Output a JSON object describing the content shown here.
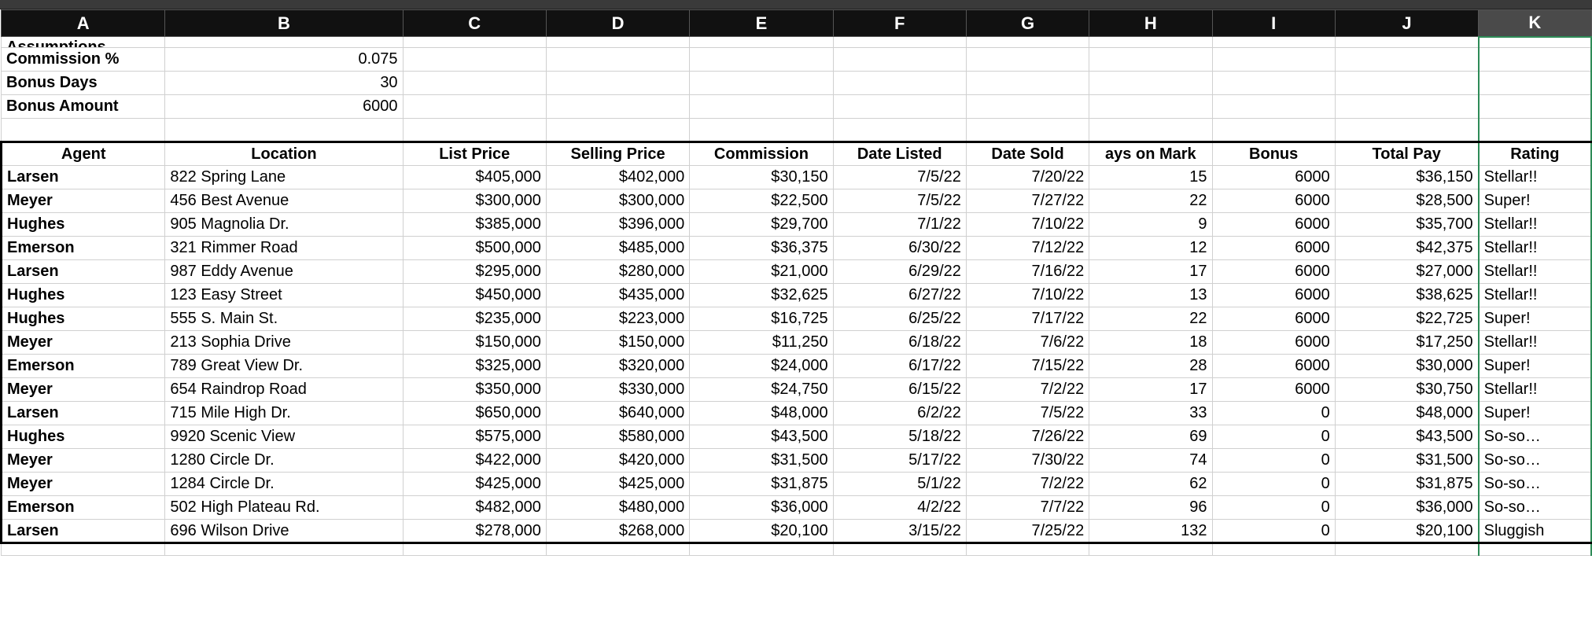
{
  "columns": [
    "A",
    "B",
    "C",
    "D",
    "E",
    "F",
    "G",
    "H",
    "I",
    "J",
    "K"
  ],
  "selected_column": "K",
  "assumptions_partial_label": "Assumptions",
  "assumptions": [
    {
      "label": "Commission %",
      "value": "0.075"
    },
    {
      "label": "Bonus Days",
      "value": "30"
    },
    {
      "label": "Bonus Amount",
      "value": "6000"
    }
  ],
  "headers": {
    "agent": "Agent",
    "location": "Location",
    "list_price": "List Price",
    "selling_price": "Selling Price",
    "commission": "Commission",
    "date_listed": "Date Listed",
    "date_sold": "Date Sold",
    "days_on_market": "ays on Mark",
    "bonus": "Bonus",
    "total_pay": "Total Pay",
    "rating": "Rating"
  },
  "rows": [
    {
      "agent": "Larsen",
      "location": "822 Spring Lane",
      "list_price": "$405,000",
      "selling_price": "$402,000",
      "commission": "$30,150",
      "date_listed": "7/5/22",
      "date_sold": "7/20/22",
      "days": "15",
      "bonus": "6000",
      "total_pay": "$36,150",
      "rating": "Stellar!!"
    },
    {
      "agent": "Meyer",
      "location": "456 Best Avenue",
      "list_price": "$300,000",
      "selling_price": "$300,000",
      "commission": "$22,500",
      "date_listed": "7/5/22",
      "date_sold": "7/27/22",
      "days": "22",
      "bonus": "6000",
      "total_pay": "$28,500",
      "rating": "Super!"
    },
    {
      "agent": "Hughes",
      "location": "905 Magnolia Dr.",
      "list_price": "$385,000",
      "selling_price": "$396,000",
      "commission": "$29,700",
      "date_listed": "7/1/22",
      "date_sold": "7/10/22",
      "days": "9",
      "bonus": "6000",
      "total_pay": "$35,700",
      "rating": "Stellar!!"
    },
    {
      "agent": "Emerson",
      "location": "321 Rimmer Road",
      "list_price": "$500,000",
      "selling_price": "$485,000",
      "commission": "$36,375",
      "date_listed": "6/30/22",
      "date_sold": "7/12/22",
      "days": "12",
      "bonus": "6000",
      "total_pay": "$42,375",
      "rating": "Stellar!!"
    },
    {
      "agent": "Larsen",
      "location": "987 Eddy Avenue",
      "list_price": "$295,000",
      "selling_price": "$280,000",
      "commission": "$21,000",
      "date_listed": "6/29/22",
      "date_sold": "7/16/22",
      "days": "17",
      "bonus": "6000",
      "total_pay": "$27,000",
      "rating": "Stellar!!"
    },
    {
      "agent": "Hughes",
      "location": "123 Easy Street",
      "list_price": "$450,000",
      "selling_price": "$435,000",
      "commission": "$32,625",
      "date_listed": "6/27/22",
      "date_sold": "7/10/22",
      "days": "13",
      "bonus": "6000",
      "total_pay": "$38,625",
      "rating": "Stellar!!"
    },
    {
      "agent": "Hughes",
      "location": "555 S. Main St.",
      "list_price": "$235,000",
      "selling_price": "$223,000",
      "commission": "$16,725",
      "date_listed": "6/25/22",
      "date_sold": "7/17/22",
      "days": "22",
      "bonus": "6000",
      "total_pay": "$22,725",
      "rating": "Super!"
    },
    {
      "agent": "Meyer",
      "location": "213 Sophia Drive",
      "list_price": "$150,000",
      "selling_price": "$150,000",
      "commission": "$11,250",
      "date_listed": "6/18/22",
      "date_sold": "7/6/22",
      "days": "18",
      "bonus": "6000",
      "total_pay": "$17,250",
      "rating": "Stellar!!"
    },
    {
      "agent": "Emerson",
      "location": "789 Great View Dr.",
      "list_price": "$325,000",
      "selling_price": "$320,000",
      "commission": "$24,000",
      "date_listed": "6/17/22",
      "date_sold": "7/15/22",
      "days": "28",
      "bonus": "6000",
      "total_pay": "$30,000",
      "rating": "Super!"
    },
    {
      "agent": "Meyer",
      "location": "654 Raindrop Road",
      "list_price": "$350,000",
      "selling_price": "$330,000",
      "commission": "$24,750",
      "date_listed": "6/15/22",
      "date_sold": "7/2/22",
      "days": "17",
      "bonus": "6000",
      "total_pay": "$30,750",
      "rating": "Stellar!!"
    },
    {
      "agent": "Larsen",
      "location": "715 Mile High Dr.",
      "list_price": "$650,000",
      "selling_price": "$640,000",
      "commission": "$48,000",
      "date_listed": "6/2/22",
      "date_sold": "7/5/22",
      "days": "33",
      "bonus": "0",
      "total_pay": "$48,000",
      "rating": "Super!"
    },
    {
      "agent": "Hughes",
      "location": "9920 Scenic View",
      "list_price": "$575,000",
      "selling_price": "$580,000",
      "commission": "$43,500",
      "date_listed": "5/18/22",
      "date_sold": "7/26/22",
      "days": "69",
      "bonus": "0",
      "total_pay": "$43,500",
      "rating": "So-so…"
    },
    {
      "agent": "Meyer",
      "location": "1280 Circle Dr.",
      "list_price": "$422,000",
      "selling_price": "$420,000",
      "commission": "$31,500",
      "date_listed": "5/17/22",
      "date_sold": "7/30/22",
      "days": "74",
      "bonus": "0",
      "total_pay": "$31,500",
      "rating": "So-so…"
    },
    {
      "agent": "Meyer",
      "location": "1284 Circle Dr.",
      "list_price": "$425,000",
      "selling_price": "$425,000",
      "commission": "$31,875",
      "date_listed": "5/1/22",
      "date_sold": "7/2/22",
      "days": "62",
      "bonus": "0",
      "total_pay": "$31,875",
      "rating": "So-so…"
    },
    {
      "agent": "Emerson",
      "location": "502 High Plateau Rd.",
      "list_price": "$482,000",
      "selling_price": "$480,000",
      "commission": "$36,000",
      "date_listed": "4/2/22",
      "date_sold": "7/7/22",
      "days": "96",
      "bonus": "0",
      "total_pay": "$36,000",
      "rating": "So-so…"
    },
    {
      "agent": "Larsen",
      "location": "696 Wilson Drive",
      "list_price": "$278,000",
      "selling_price": "$268,000",
      "commission": "$20,100",
      "date_listed": "3/15/22",
      "date_sold": "7/25/22",
      "days": "132",
      "bonus": "0",
      "total_pay": "$20,100",
      "rating": "Sluggish"
    }
  ]
}
